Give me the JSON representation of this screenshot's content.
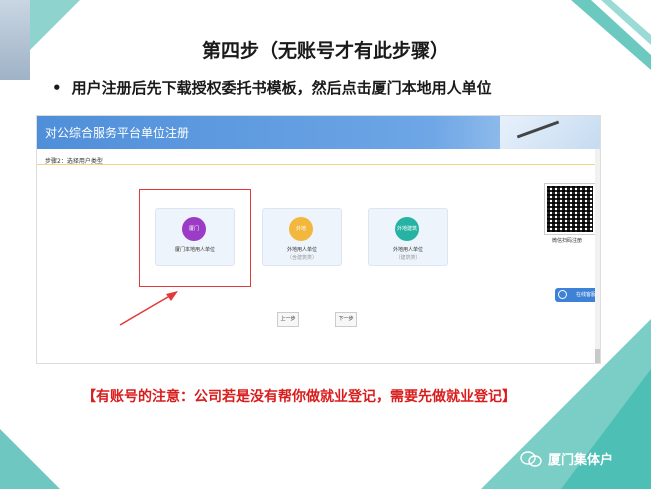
{
  "slide": {
    "title": "第四步（无账号才有此步骤）",
    "bullet": "•",
    "subtitle": "用户注册后先下载授权委托书模板，然后点击厦门本地用人单位"
  },
  "portal": {
    "header_title": "对公综合服务平台单位注册",
    "breadcrumb": "步骤2：选择用户类型",
    "cards": [
      {
        "icon_text": "厦门",
        "label": "厦门本地用人单位",
        "sub": "",
        "color": "#9b3cc7"
      },
      {
        "icon_text": "外地",
        "label": "外地用人单位",
        "sub": "（含建筑类）",
        "color": "#f2b73c"
      },
      {
        "icon_text": "外地建筑",
        "label": "外地用人单位",
        "sub": "（建筑类）",
        "color": "#27b3a3"
      }
    ],
    "qr_label": "微信扫码注册",
    "online_button": "在线客服",
    "prev_button": "上一步",
    "next_button": "下一步"
  },
  "note": "【有账号的注意：公司若是没有帮你做就业登记，需要先做就业登记】",
  "brand": {
    "name": "厦门集体户",
    "icon": "wechat-icon"
  }
}
